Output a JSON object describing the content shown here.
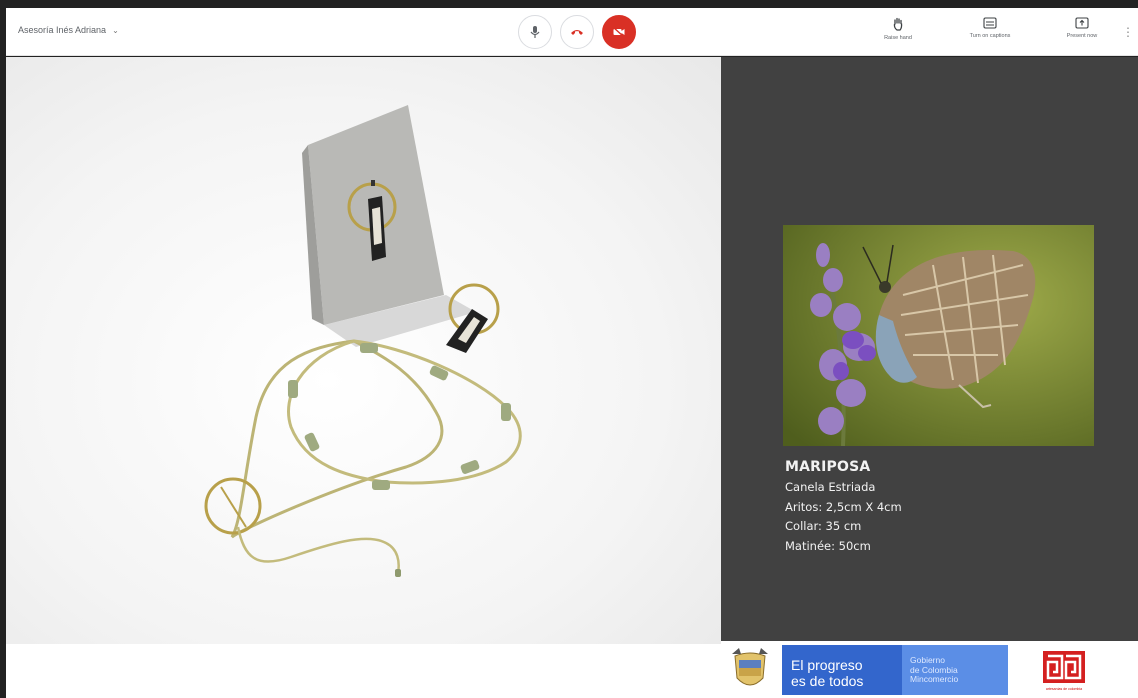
{
  "meeting": {
    "title": "Asesoría Inés Adriana",
    "chevron": "⌄"
  },
  "call_controls": [
    {
      "name": "mic-button",
      "icon": "microphone-icon"
    },
    {
      "name": "end-call-button",
      "icon": "hang-up-icon"
    },
    {
      "name": "camera-button",
      "icon": "camera-off-icon",
      "color": "#d93025"
    }
  ],
  "actions": [
    {
      "label": "Raise hand",
      "icon": "hand-icon"
    },
    {
      "label": "Turn on captions",
      "icon": "captions-icon"
    },
    {
      "label": "Present now",
      "icon": "present-icon"
    }
  ],
  "product": {
    "name": "MARIPOSA",
    "lines": [
      "Canela Estriada",
      "Aritos: 2,5cm X 4cm",
      "Collar: 35 cm",
      "Matinée: 50cm"
    ]
  },
  "banner": {
    "progreso_line1": "El progreso",
    "progreso_line2": "es de todos",
    "gobierno_line1": "Gobierno",
    "gobierno_line2": "de Colombia",
    "gobierno_line3": "Mincomercio",
    "artesanias_tag": "artesanías de colombia"
  },
  "colors": {
    "end_call_red": "#d93025",
    "panel_dark": "#414141",
    "progreso_blue": "#3366cc",
    "gobierno_blue": "#5b8ee6"
  }
}
